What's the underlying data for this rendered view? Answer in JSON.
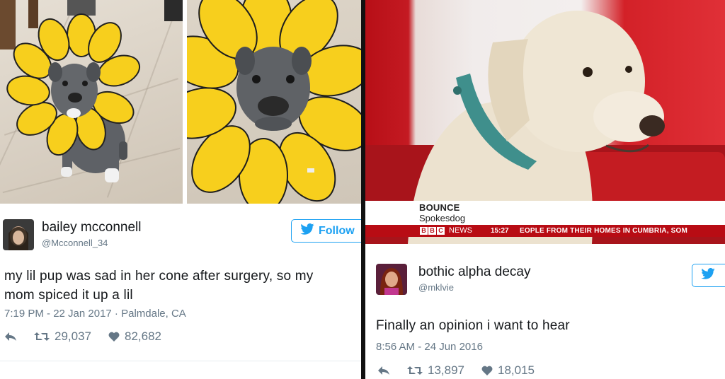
{
  "left_tweet": {
    "name": "bailey mcconnell",
    "handle": "@Mcconnell_34",
    "follow_label": "Follow",
    "text_line1": "my lil pup was sad in her cone after surgery, so my",
    "text_line2": "mom spiced it up a lil",
    "meta": "7:19 PM - 22 Jan 2017 · Palmdale, CA",
    "retweets": "29,037",
    "likes": "82,682"
  },
  "right_tweet": {
    "name": "bothic alpha decay",
    "handle": "@mklvie",
    "text": "Finally an opinion i want to hear",
    "meta": "8:56 AM - 24 Jun 2016",
    "retweets": "13,897",
    "likes": "18,015"
  },
  "tv_caption": {
    "name": "BOUNCE",
    "role": "Spokesdog",
    "channel_letters": [
      "B",
      "B",
      "C"
    ],
    "channel_suffix": "NEWS",
    "time": "15:27",
    "ticker": "EOPLE FROM THEIR HOMES IN CUMBRIA, SOM"
  },
  "colors": {
    "twitter_blue": "#1da1f2",
    "bbc_red": "#b80c14",
    "petal_yellow": "#f7cf1d",
    "secondary_text": "#657786"
  }
}
